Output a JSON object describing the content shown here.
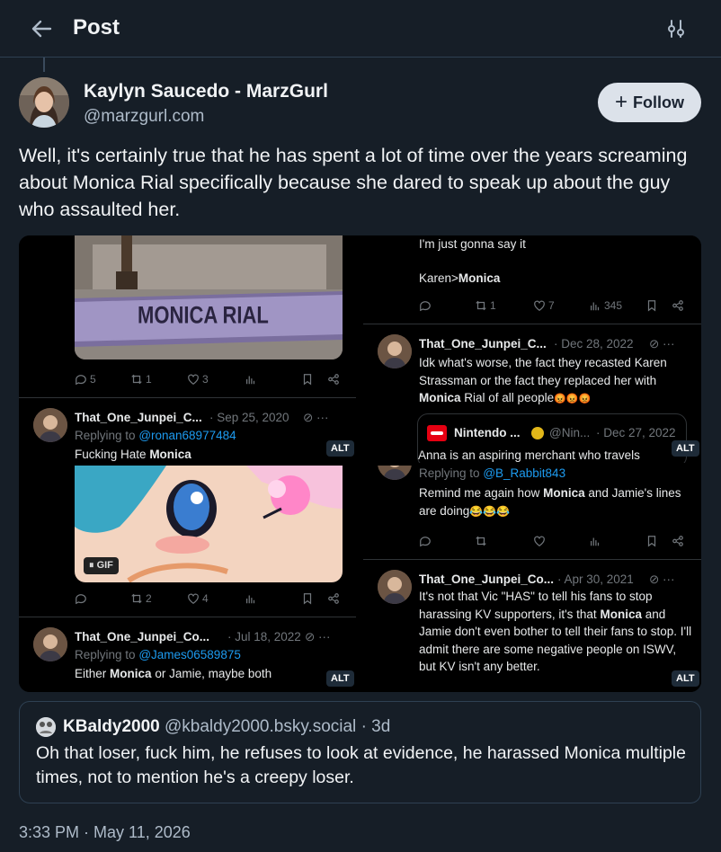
{
  "header": {
    "title": "Post",
    "back_icon": "arrow-left-icon",
    "filter_icon": "sliders-icon"
  },
  "author": {
    "display_name": "Kaylyn Saucedo - MarzGurl",
    "handle": "@marzgurl.com"
  },
  "follow_button": {
    "label": "Follow"
  },
  "post": {
    "text": "Well, it's certainly true that he has spent a lot of time over the years screaming about Monica Rial specifically because she dared to speak up about the guy who assaulted her.",
    "timestamp": "3:33 PM · May 11, 2026"
  },
  "images": [
    {
      "sign_text": "MONICA RIAL",
      "actions": {
        "replies": "5",
        "reposts": "1",
        "likes": "3"
      },
      "tweet": {
        "name": "That_One_Junpei_C...",
        "date": "· Sep 25, 2020",
        "replying_prefix": "Replying to",
        "replying_to": "@ronan68977484",
        "text_plain": "Fucking Hate",
        "text_bold": "Monica"
      },
      "alt": "ALT"
    },
    {
      "top_text_1": "I'm just gonna say it",
      "top_text_2": "Karen>",
      "top_text_2_bold": "Monica",
      "actions": {
        "reposts": "1",
        "likes": "7",
        "views": "345"
      },
      "tweet": {
        "name": "That_One_Junpei_C...",
        "date": "· Dec 28, 2022",
        "text_plain": "Idk what's worse, the fact they recasted Karen Strassman or the fact they replaced her with",
        "text_bold": "Monica",
        "text_after": "Rial of all people",
        "emoji": "😡😡😡"
      },
      "quoted": {
        "name": "Nintendo ...",
        "handle": "@Nin...",
        "date": "· Dec 27, 2022",
        "text": "Anna is an aspiring merchant who travels"
      },
      "alt": "ALT"
    },
    {
      "gif_label": "GIF",
      "actions": {
        "reposts": "2",
        "likes": "4"
      },
      "tweet": {
        "name": "That_One_Junpei_Co...",
        "date": "· Jul 18, 2022",
        "replying_prefix": "Replying to",
        "replying_to": "@James06589875",
        "text_plain_before": "Either",
        "text_bold": "Monica",
        "text_plain_after": "or Jamie, maybe both"
      },
      "alt": "ALT"
    },
    {
      "replying_prefix": "Replying to",
      "replying_to": "@B_Rabbit843",
      "top_text_before": "Remind me again how",
      "top_text_bold": "Monica",
      "top_text_after": "and Jamie's lines are doing",
      "top_emoji": "😂😂😂",
      "tweet": {
        "name": "That_One_Junpei_Co...",
        "date": "· Apr 30, 2021",
        "text_before": "It's not that Vic \"HAS\" to tell his fans to stop harassing KV supporters, it's that",
        "text_bold": "Monica",
        "text_after": "and Jamie don't even bother to tell their fans to stop. I'll admit there are some negative people on ISWV, but KV isn't any better."
      },
      "alt": "ALT"
    }
  ],
  "quote": {
    "display_name": "KBaldy2000",
    "handle": "@kbaldy2000.bsky.social",
    "age": "· 3d",
    "text": "Oh that loser, fuck him, he refuses to look at evidence, he harassed Monica multiple times, not to mention he's a creepy loser."
  },
  "colors": {
    "background": "#161e27",
    "border": "#2e4052",
    "muted": "#aebbc9",
    "link": "#1d9bf0"
  }
}
